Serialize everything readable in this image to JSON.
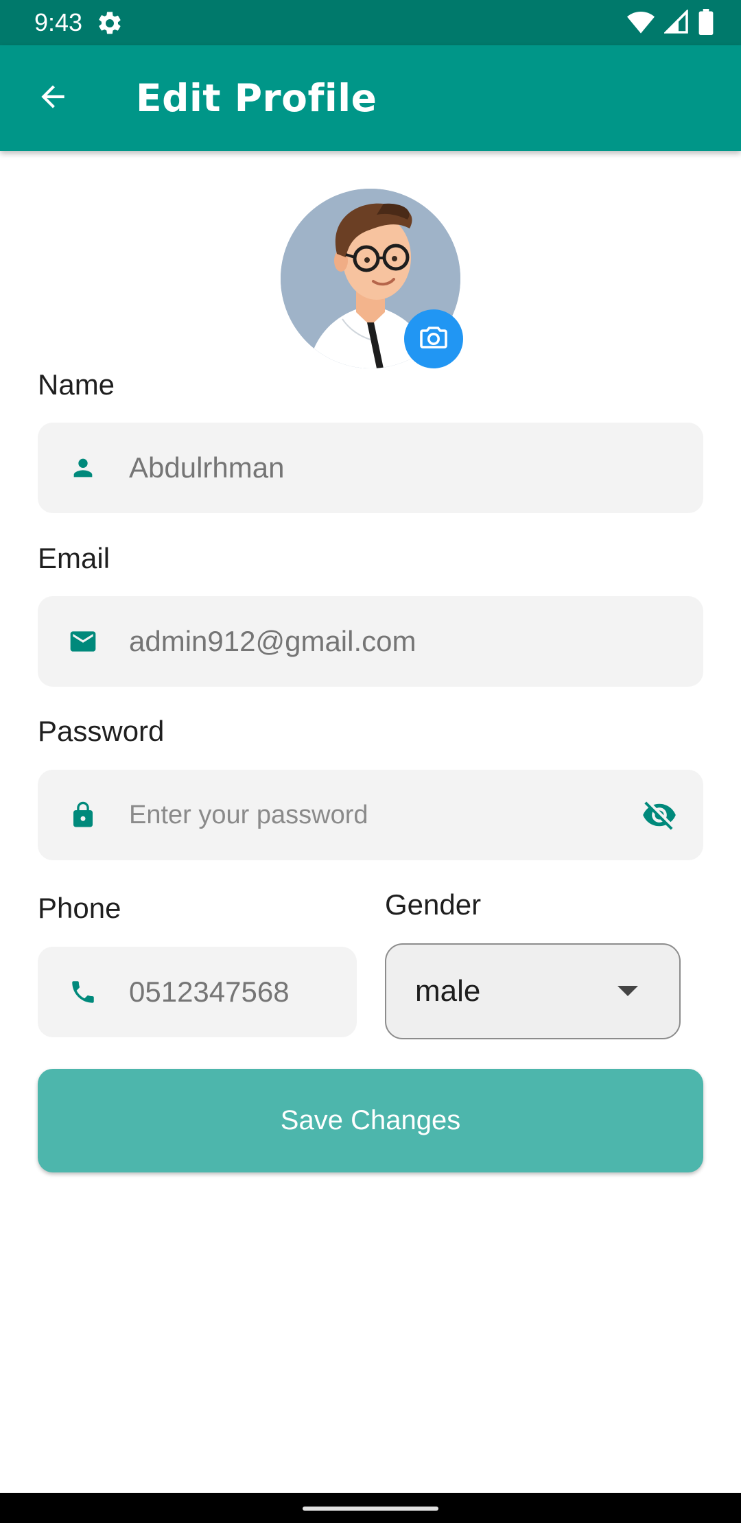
{
  "status_bar": {
    "time": "9:43",
    "icons": [
      "settings-gear-icon",
      "wifi-icon",
      "cell-signal-icon",
      "battery-icon"
    ]
  },
  "app_bar": {
    "back_icon": "arrow-back-icon",
    "title": "Edit Profile",
    "color": "#009688"
  },
  "avatar": {
    "camera_icon": "camera-icon",
    "camera_color": "#2196f3"
  },
  "form": {
    "name": {
      "label": "Name",
      "value": "Abdulrhman",
      "icon": "person-icon"
    },
    "email": {
      "label": "Email",
      "value": "admin912@gmail.com",
      "icon": "mail-icon"
    },
    "password": {
      "label": "Password",
      "placeholder": "Enter your password",
      "icon": "lock-icon",
      "toggle_icon": "visibility-off-icon"
    },
    "phone": {
      "label": "Phone",
      "value": "0512347568",
      "icon": "phone-icon"
    },
    "gender": {
      "label": "Gender",
      "value": "male",
      "icon": "dropdown-arrow-icon"
    }
  },
  "save_button": {
    "label": "Save Changes",
    "color": "#4db6ac"
  },
  "accent_color": "#00897b"
}
